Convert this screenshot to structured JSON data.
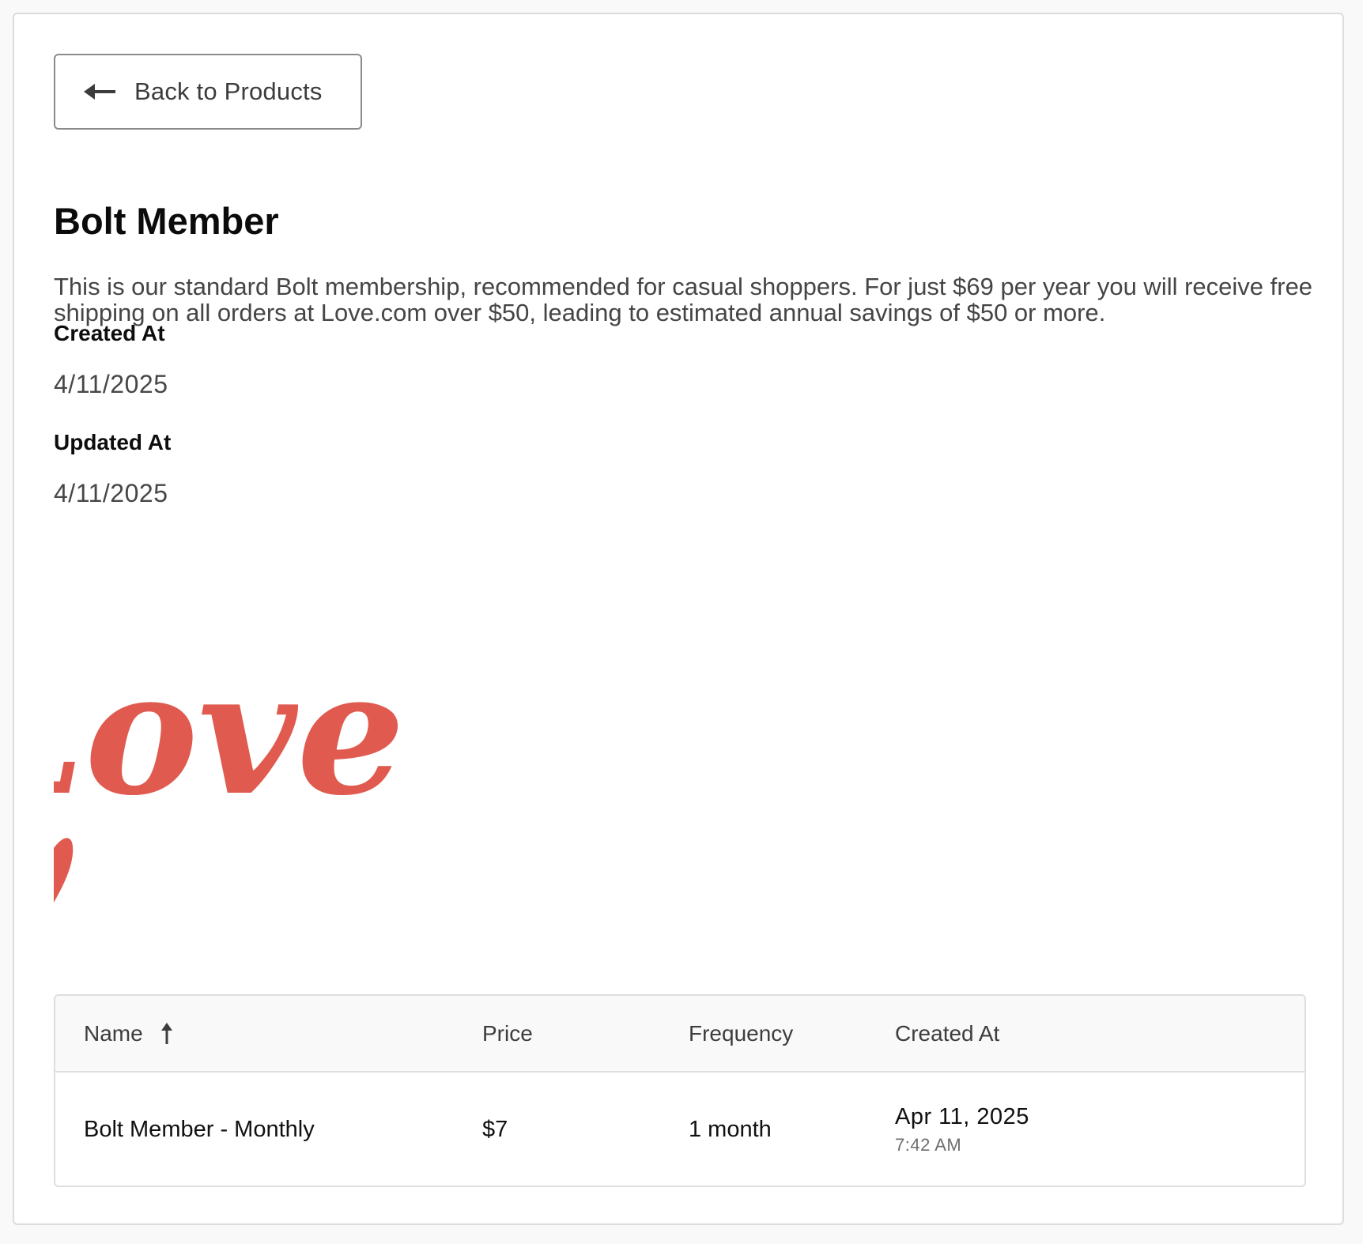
{
  "back_button": {
    "label": "Back to Products",
    "icon": "arrow-left-icon"
  },
  "product": {
    "title": "Bolt Member",
    "description": "This is our standard Bolt membership, recommended for casual shoppers. For just $69 per year you will receive free shipping on all orders at Love.com over $50, leading to estimated annual savings of $50 or more.",
    "created_at_label": "Created At",
    "created_at_value": "4/11/2025",
    "updated_at_label": "Updated At",
    "updated_at_value": "4/11/2025",
    "logo": {
      "text": "Love.",
      "color": "#e05a4f"
    }
  },
  "prices_table": {
    "columns": [
      {
        "label": "Name",
        "sort_icon": "arrow-up-icon"
      },
      {
        "label": "Price"
      },
      {
        "label": "Frequency"
      },
      {
        "label": "Created At"
      }
    ],
    "rows": [
      {
        "name": "Bolt Member - Monthly",
        "price": "$7",
        "frequency": "1 month",
        "created_date": "Apr 11, 2025",
        "created_time": "7:42 AM"
      }
    ]
  }
}
